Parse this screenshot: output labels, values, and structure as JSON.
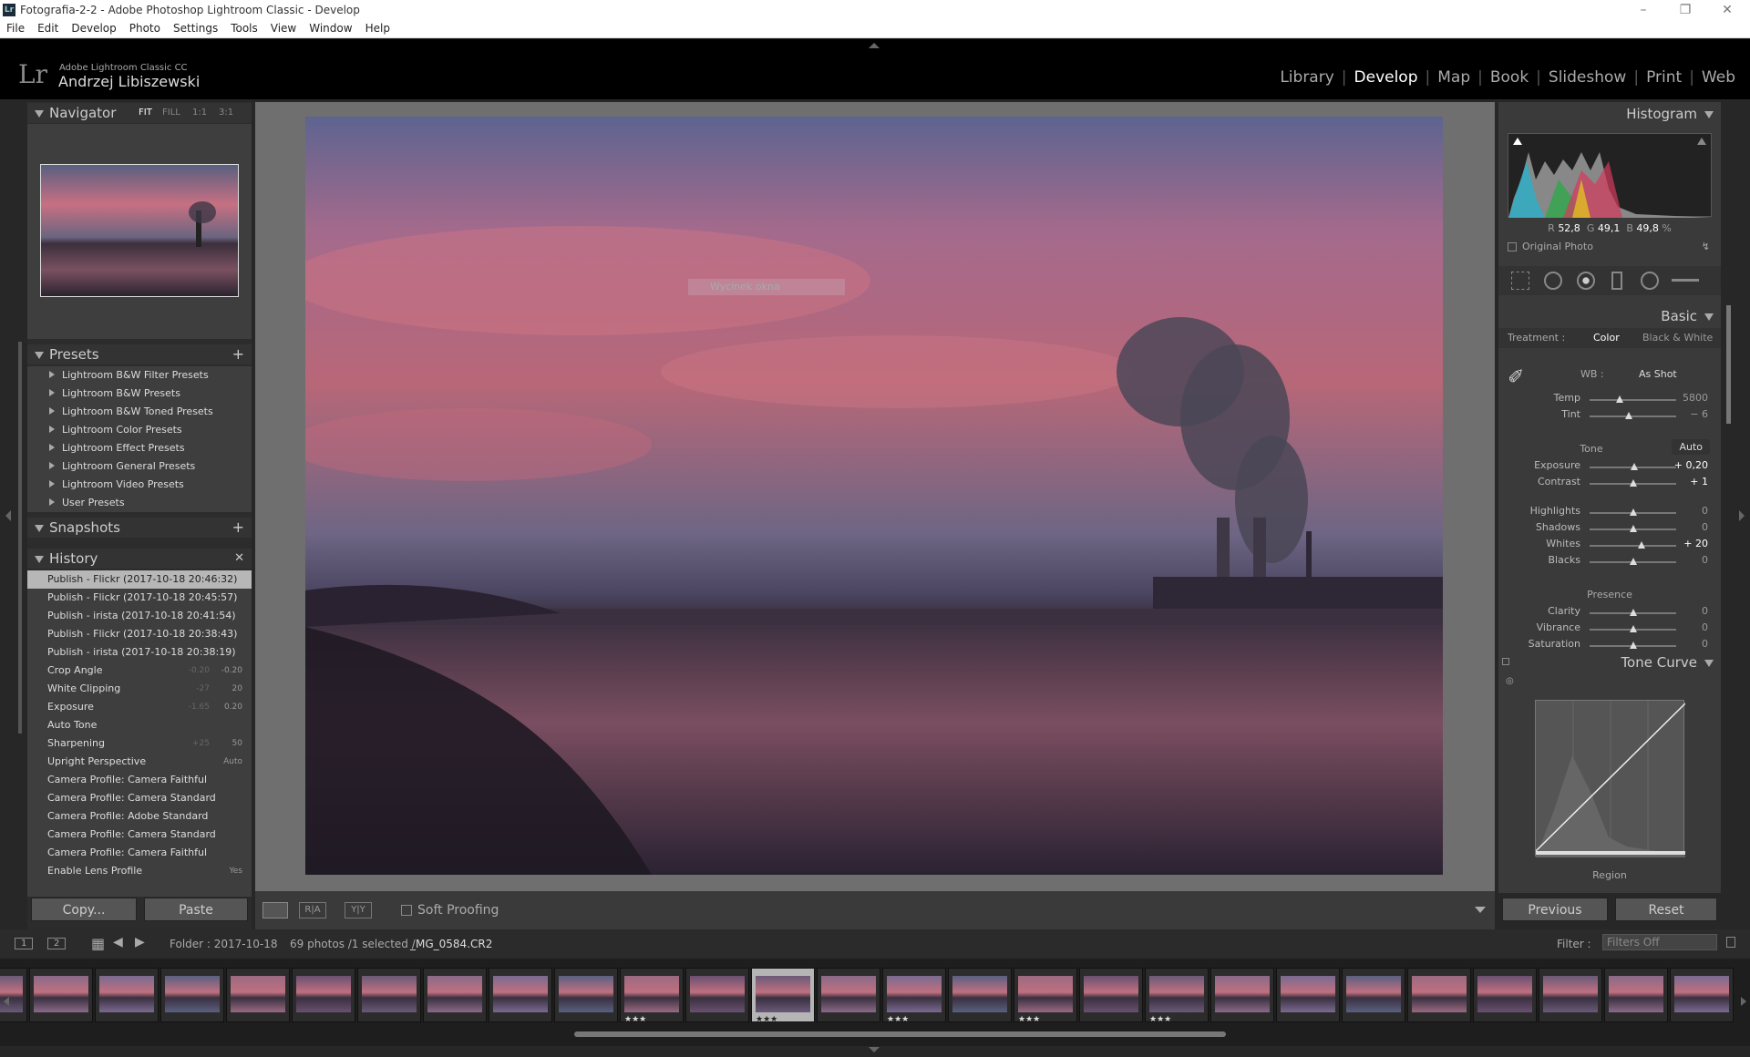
{
  "window": {
    "title": "Fotografia-2-2 - Adobe Photoshop Lightroom Classic - Develop",
    "app_badge": "Lr"
  },
  "menu": [
    "File",
    "Edit",
    "Develop",
    "Photo",
    "Settings",
    "Tools",
    "View",
    "Window",
    "Help"
  ],
  "identity": {
    "logo": "Lr",
    "product": "Adobe Lightroom Classic CC",
    "user": "Andrzej Libiszewski"
  },
  "modules": [
    "Library",
    "Develop",
    "Map",
    "Book",
    "Slideshow",
    "Print",
    "Web"
  ],
  "active_module": "Develop",
  "navigator": {
    "title": "Navigator",
    "zoom": [
      "FIT",
      "FILL",
      "1:1",
      "3:1"
    ]
  },
  "presets": {
    "title": "Presets",
    "items": [
      "Lightroom B&W Filter Presets",
      "Lightroom B&W Presets",
      "Lightroom B&W Toned Presets",
      "Lightroom Color Presets",
      "Lightroom Effect Presets",
      "Lightroom General Presets",
      "Lightroom Video Presets",
      "User Presets"
    ]
  },
  "snapshots": {
    "title": "Snapshots"
  },
  "history": {
    "title": "History",
    "items": [
      {
        "label": "Publish - Flickr (2017-10-18 20:46:32)",
        "old": "",
        "new": ""
      },
      {
        "label": "Publish - Flickr (2017-10-18 20:45:57)",
        "old": "",
        "new": ""
      },
      {
        "label": "Publish - irista (2017-10-18 20:41:54)",
        "old": "",
        "new": ""
      },
      {
        "label": "Publish - Flickr (2017-10-18 20:38:43)",
        "old": "",
        "new": ""
      },
      {
        "label": "Publish - irista (2017-10-18 20:38:19)",
        "old": "",
        "new": ""
      },
      {
        "label": "Crop Angle",
        "old": "-0.20",
        "new": "-0.20"
      },
      {
        "label": "White Clipping",
        "old": "-27",
        "new": "20"
      },
      {
        "label": "Exposure",
        "old": "-1.65",
        "new": "0.20"
      },
      {
        "label": "Auto Tone",
        "old": "",
        "new": ""
      },
      {
        "label": "Sharpening",
        "old": "+25",
        "new": "50"
      },
      {
        "label": "Upright Perspective",
        "old": "",
        "new": "Auto"
      },
      {
        "label": "Camera Profile: Camera Faithful",
        "old": "",
        "new": ""
      },
      {
        "label": "Camera Profile: Camera Standard",
        "old": "",
        "new": ""
      },
      {
        "label": "Camera Profile: Adobe Standard",
        "old": "",
        "new": ""
      },
      {
        "label": "Camera Profile: Camera Standard",
        "old": "",
        "new": ""
      },
      {
        "label": "Camera Profile: Camera Faithful",
        "old": "",
        "new": ""
      },
      {
        "label": "Enable Lens Profile",
        "old": "",
        "new": "Yes"
      }
    ]
  },
  "left_buttons": {
    "copy": "Copy...",
    "paste": "Paste"
  },
  "overlay": {
    "tooltip": "Wycinek okna"
  },
  "toolbar": {
    "soft_proofing": "Soft Proofing",
    "before_after": "R|A",
    "yy": "Y|Y"
  },
  "histogram": {
    "title": "Histogram",
    "r_label": "R",
    "r": "52,8",
    "g_label": "G",
    "g": "49,1",
    "b_label": "B",
    "b": "49,8",
    "unit": "%",
    "original_photo": "Original Photo"
  },
  "basic": {
    "title": "Basic",
    "treatment_label": "Treatment :",
    "color": "Color",
    "bw": "Black & White",
    "wb_label": "WB :",
    "wb_value": "As Shot",
    "tone_label": "Tone",
    "auto": "Auto",
    "presence_label": "Presence",
    "sliders": [
      {
        "label": "Temp",
        "value": "5800",
        "pos": 0.35,
        "bright": false
      },
      {
        "label": "Tint",
        "value": "− 6",
        "pos": 0.45,
        "bright": false
      },
      {
        "label": "Exposure",
        "value": "+ 0,20",
        "pos": 0.52,
        "bright": true
      },
      {
        "label": "Contrast",
        "value": "+ 1",
        "pos": 0.5,
        "bright": true
      },
      {
        "label": "Highlights",
        "value": "0",
        "pos": 0.5,
        "bright": false
      },
      {
        "label": "Shadows",
        "value": "0",
        "pos": 0.5,
        "bright": false
      },
      {
        "label": "Whites",
        "value": "+ 20",
        "pos": 0.6,
        "bright": true
      },
      {
        "label": "Blacks",
        "value": "0",
        "pos": 0.5,
        "bright": false
      },
      {
        "label": "Clarity",
        "value": "0",
        "pos": 0.5,
        "bright": false
      },
      {
        "label": "Vibrance",
        "value": "0",
        "pos": 0.5,
        "bright": false
      },
      {
        "label": "Saturation",
        "value": "0",
        "pos": 0.5,
        "bright": false
      }
    ]
  },
  "tone_curve": {
    "title": "Tone Curve",
    "region": "Region"
  },
  "right_buttons": {
    "previous": "Previous",
    "reset": "Reset"
  },
  "filmbar": {
    "screen1": "1",
    "screen2": "2",
    "folder": "Folder : 2017-10-18",
    "count": "69 photos /1 selected /",
    "filename": "_MG_0584.CR2",
    "filter_label": "Filter :",
    "filter_value": "Filters Off"
  },
  "filmstrip": {
    "rated": [
      10,
      12,
      14,
      16,
      18
    ],
    "selected": 12,
    "stars": "★★★"
  }
}
